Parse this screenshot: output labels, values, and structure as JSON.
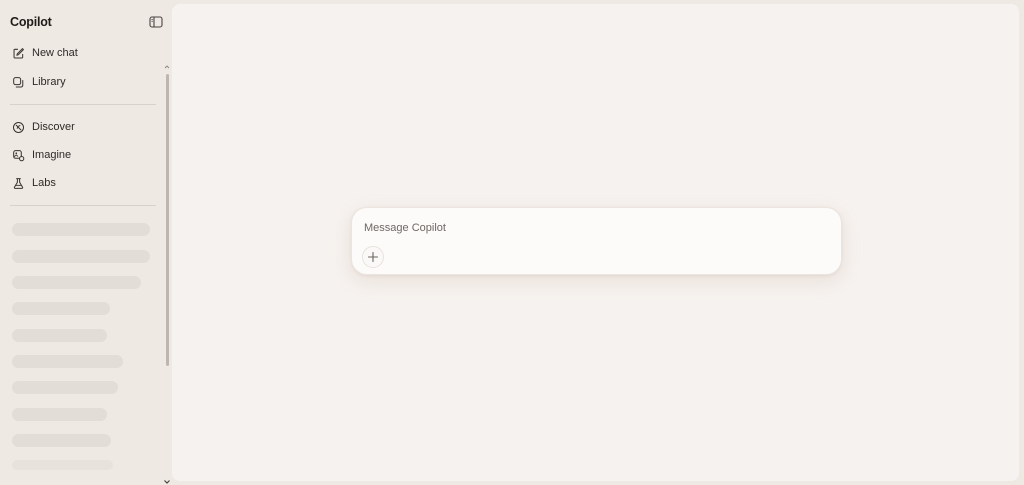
{
  "sidebar": {
    "brand": "Copilot",
    "toggle_icon": "sidebar-panel-icon",
    "items": [
      {
        "label": "New chat",
        "icon": "compose-icon"
      },
      {
        "label": "Library",
        "icon": "library-icon"
      },
      {
        "label": "Discover",
        "icon": "compass-icon"
      },
      {
        "label": "Imagine",
        "icon": "image-icon"
      },
      {
        "label": "Labs",
        "icon": "flask-icon"
      }
    ],
    "history_state": "loading"
  },
  "composer": {
    "placeholder": "Message Copilot",
    "value": "",
    "add_icon": "plus-icon"
  },
  "colors": {
    "sidebar_bg": "#efe9e4",
    "main_bg": "#f6f2ef",
    "composer_bg": "#fcfbfa",
    "skeleton": "#e3ddd7"
  }
}
